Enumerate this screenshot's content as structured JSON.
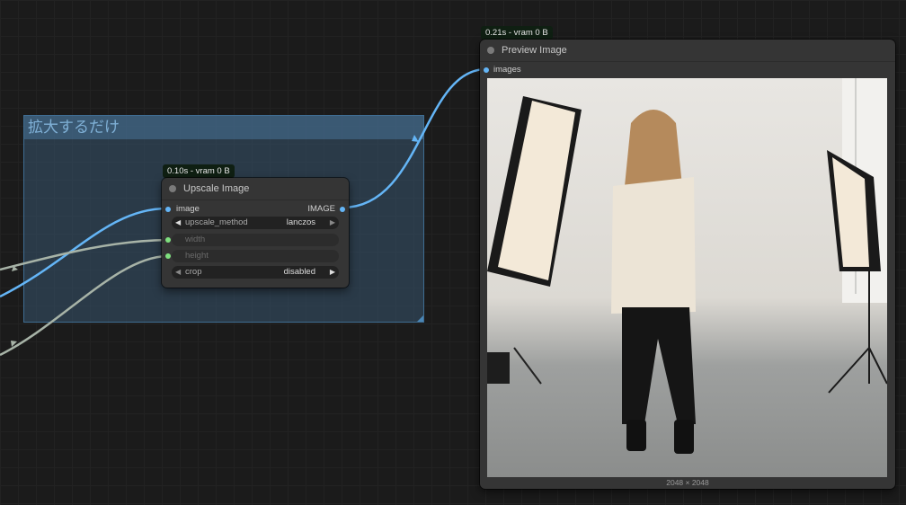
{
  "group": {
    "title": "拡大するだけ"
  },
  "upscale_node": {
    "timing": "0.10s - vram 0 B",
    "title": "Upscale Image",
    "input_label": "image",
    "output_label": "IMAGE",
    "widgets": {
      "upscale_method": {
        "label": "upscale_method",
        "value": "lanczos"
      },
      "width": {
        "label": "width"
      },
      "height": {
        "label": "height"
      },
      "crop": {
        "label": "crop",
        "value": "disabled"
      }
    }
  },
  "preview_node": {
    "timing": "0.21s - vram 0 B",
    "title": "Preview Image",
    "input_label": "images",
    "image_size": "2048 × 2048"
  },
  "colors": {
    "image_link": "#64b5f6",
    "int_link": "#a7b3a7",
    "int_slot": "#7fe07f"
  }
}
